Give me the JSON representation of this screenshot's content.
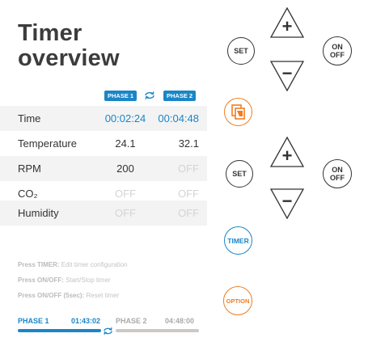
{
  "title": {
    "line1": "Timer",
    "line2": "overview"
  },
  "phase_headers": {
    "phase1": "PHASE 1",
    "phase2": "PHASE 2",
    "cycle_icon": "cycle-arrows-icon"
  },
  "rows": [
    {
      "label": "Time",
      "p1": "00:02:24",
      "p2": "00:04:48"
    },
    {
      "label": "Temperature",
      "p1": "24.1",
      "p2": "32.1"
    },
    {
      "label": "RPM",
      "p1": "200",
      "p2": "OFF"
    },
    {
      "label": "CO₂",
      "p1": "OFF",
      "p2": "OFF"
    },
    {
      "label": "Humidity",
      "p1": "OFF",
      "p2": "OFF"
    }
  ],
  "help": [
    {
      "key": "Press TIMER:",
      "text": " Edit timer configuration"
    },
    {
      "key": "Press ON/OFF:",
      "text": " Start/Stop timer"
    },
    {
      "key": "Press ON/OFF (5sec):",
      "text": " Reset timer"
    }
  ],
  "footer": {
    "phase1_label": "PHASE 1",
    "phase1_time": "01:43:02",
    "phase2_label": "PHASE 2",
    "phase2_time": "04:48:00",
    "phase1_progress": 1.0,
    "phase2_progress": 0.0
  },
  "controls": {
    "set_label": "SET",
    "on_label": "ON",
    "off_label": "OFF",
    "timer_label": "TIMER",
    "option_label": "OPTION",
    "plus_symbol": "+",
    "minus_symbol": "−"
  },
  "colors": {
    "accent_blue": "#1a86c7",
    "accent_orange": "#ee7d22",
    "off_gray": "#d4d4d4"
  }
}
